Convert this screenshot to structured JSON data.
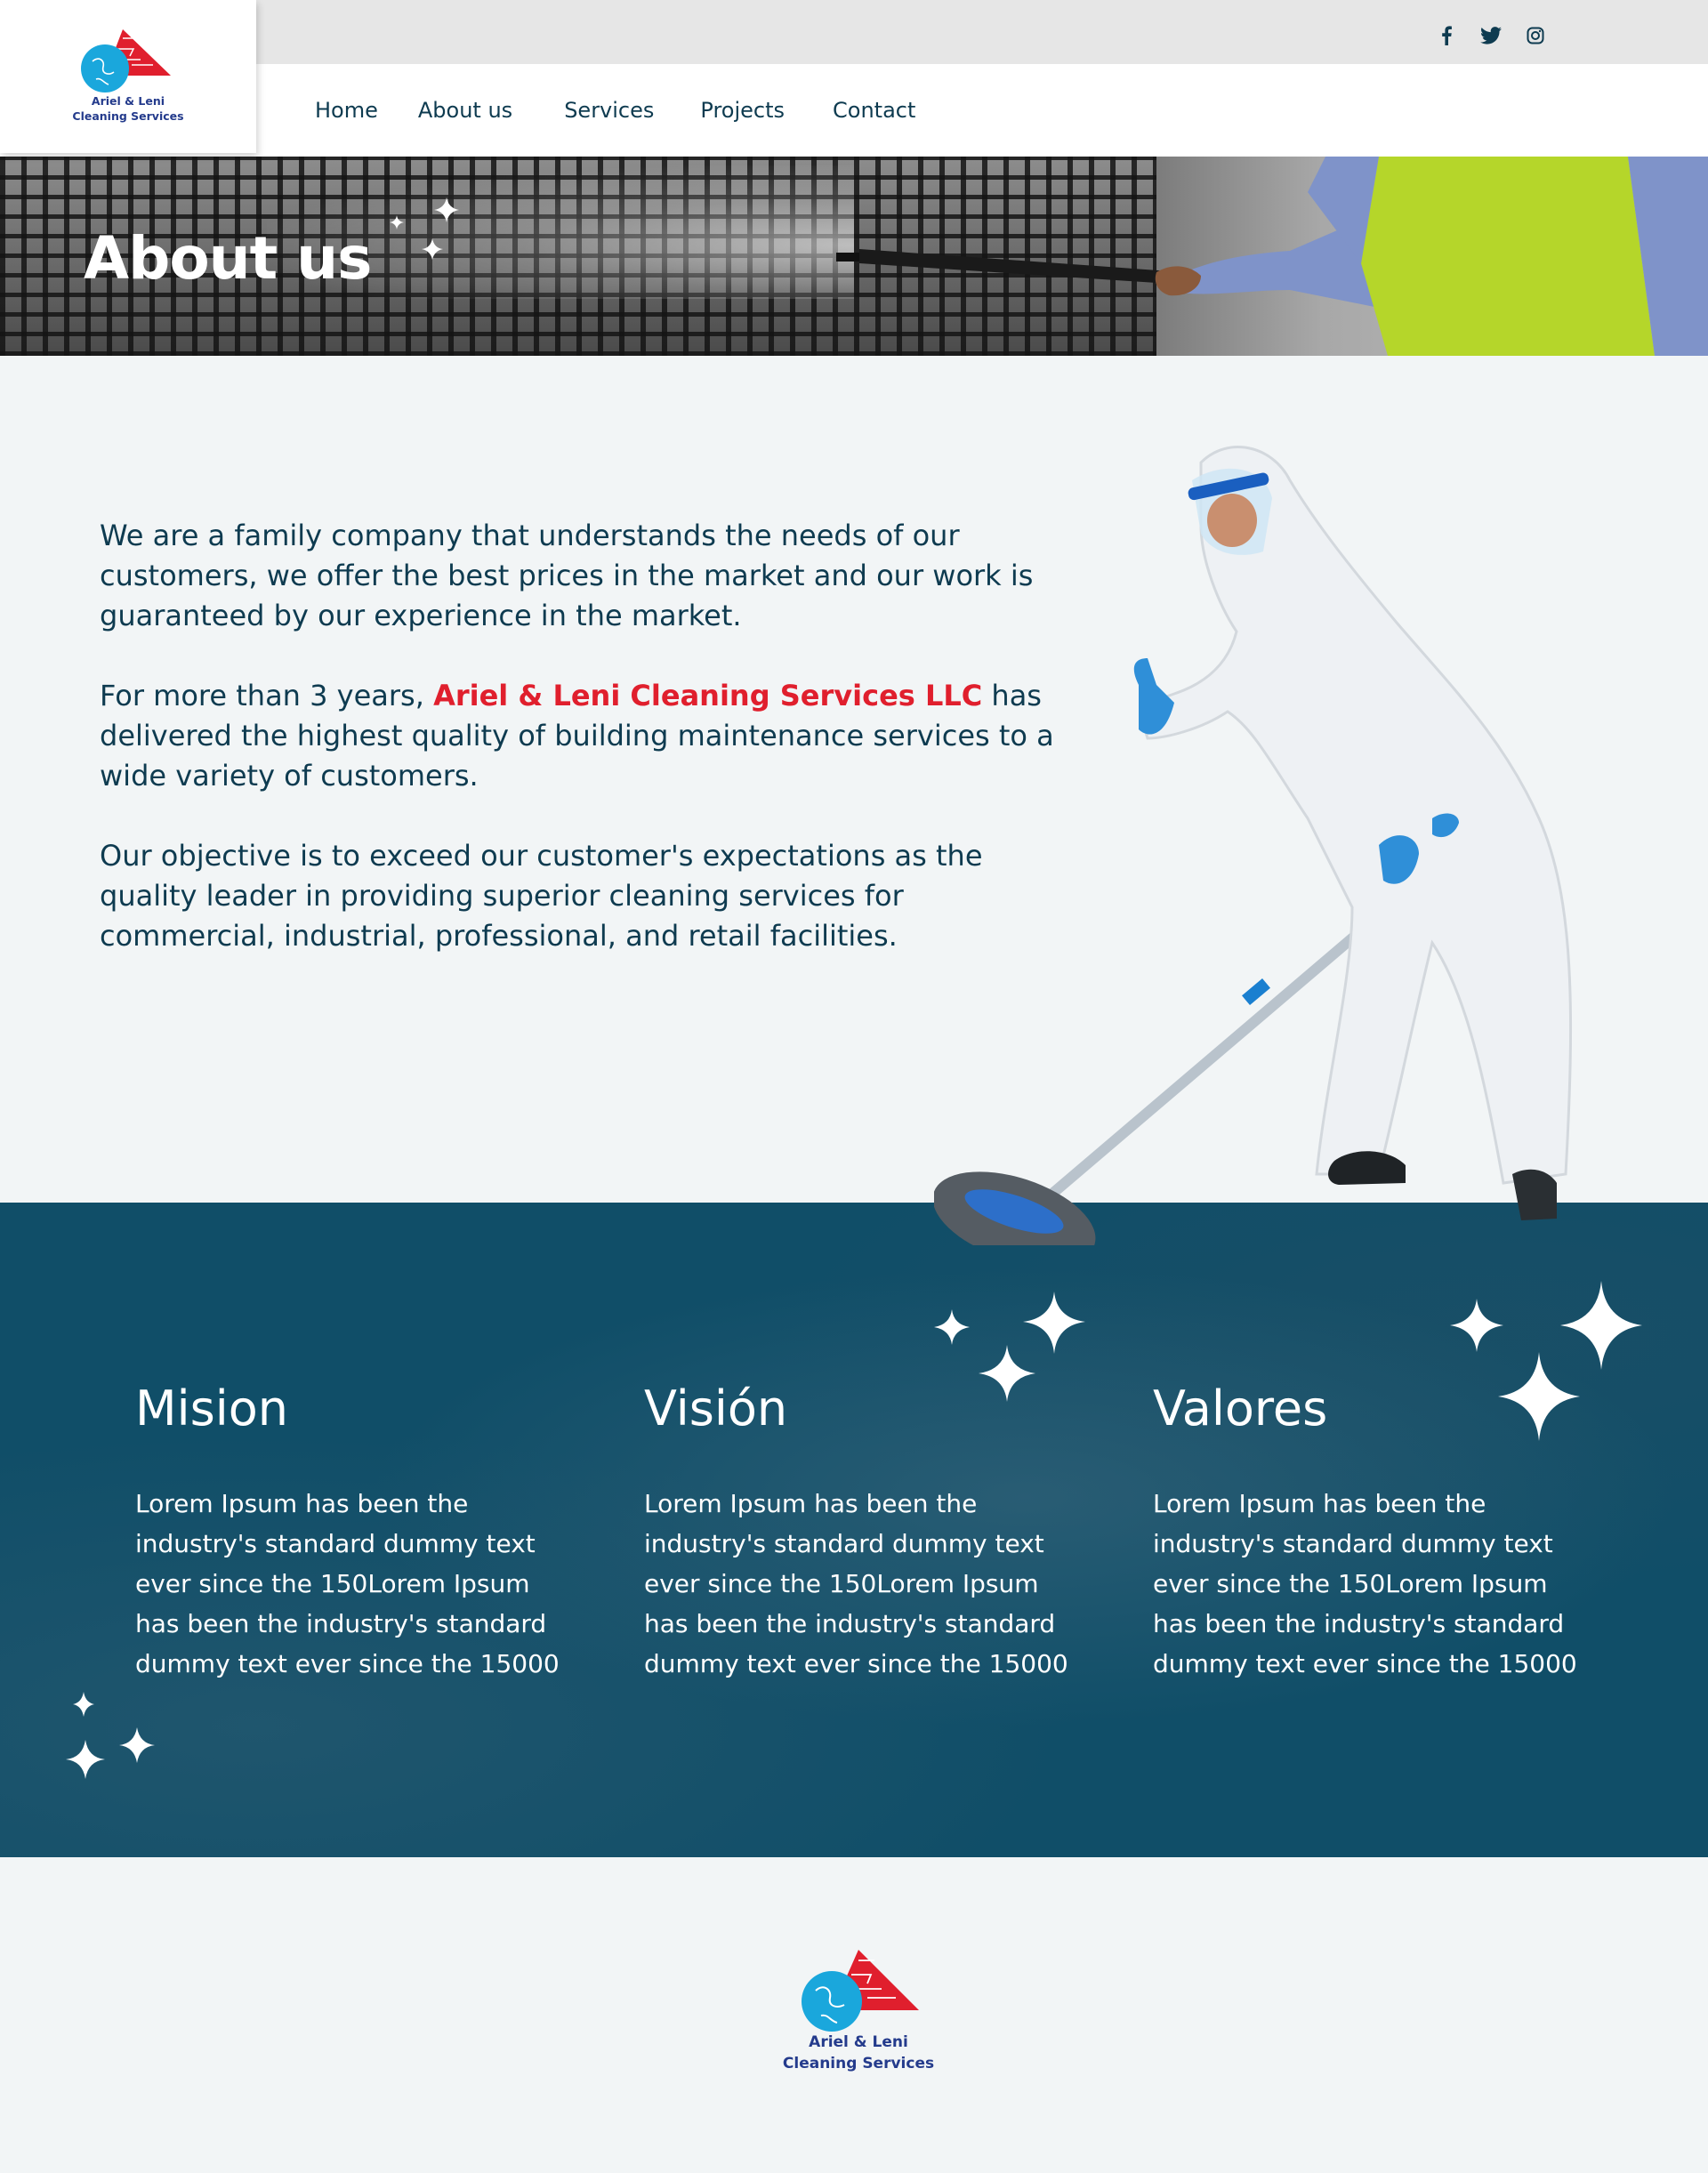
{
  "brand": {
    "name_line1": "Ariel & Leni",
    "name_line2": "Cleaning Services",
    "colors": {
      "red": "#e01f2d",
      "blue": "#1aa7dc",
      "navy": "#243b8c",
      "teal": "#104e68"
    }
  },
  "social": [
    {
      "name": "facebook",
      "icon": "facebook-icon"
    },
    {
      "name": "twitter",
      "icon": "twitter-icon"
    },
    {
      "name": "instagram",
      "icon": "instagram-icon"
    }
  ],
  "nav": {
    "items": [
      "Home",
      "About us",
      "Services",
      "Projects",
      "Contact"
    ]
  },
  "hero": {
    "title": "About us"
  },
  "about": {
    "para1": "We are a family company that understands the needs of our customers, we offer the best prices in the market and our work is guaranteed by our experience in the market.",
    "para2_prefix": "For more than 3 years, ",
    "para2_highlight": "Ariel & Leni Cleaning Services LLC",
    "para2_suffix": " has delivered the highest quality of building maintenance services to a wide variety of customers.",
    "para3": "Our objective is to exceed our customer's expectations as the quality leader in providing superior cleaning services for commercial, industrial, professional, and retail facilities."
  },
  "values": [
    {
      "title": "Mision",
      "text": "Lorem Ipsum has been the industry's standard dummy text ever since the 150Lorem Ipsum has been the industry's standard dummy text ever since the 15000"
    },
    {
      "title": "Visión",
      "text": "Lorem Ipsum has been the industry's standard dummy text ever since the 150Lorem Ipsum has been the industry's standard dummy text ever since the 15000"
    },
    {
      "title": "Valores",
      "text": "Lorem Ipsum has been the industry's standard dummy text ever since the 150Lorem Ipsum has been the industry's standard dummy text ever since the 15000"
    }
  ],
  "footer": {
    "name_line1": "Ariel & Leni",
    "name_line2": "Cleaning Services"
  }
}
